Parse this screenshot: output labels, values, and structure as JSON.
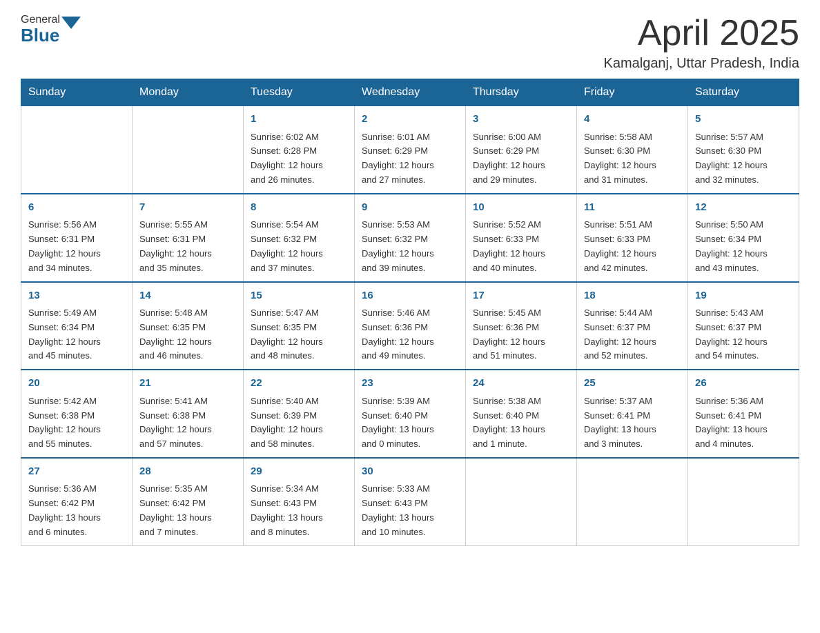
{
  "header": {
    "logo_general": "General",
    "logo_blue": "Blue",
    "month_title": "April 2025",
    "location": "Kamalganj, Uttar Pradesh, India"
  },
  "days_of_week": [
    "Sunday",
    "Monday",
    "Tuesday",
    "Wednesday",
    "Thursday",
    "Friday",
    "Saturday"
  ],
  "weeks": [
    [
      {
        "day": "",
        "info": ""
      },
      {
        "day": "",
        "info": ""
      },
      {
        "day": "1",
        "info": "Sunrise: 6:02 AM\nSunset: 6:28 PM\nDaylight: 12 hours\nand 26 minutes."
      },
      {
        "day": "2",
        "info": "Sunrise: 6:01 AM\nSunset: 6:29 PM\nDaylight: 12 hours\nand 27 minutes."
      },
      {
        "day": "3",
        "info": "Sunrise: 6:00 AM\nSunset: 6:29 PM\nDaylight: 12 hours\nand 29 minutes."
      },
      {
        "day": "4",
        "info": "Sunrise: 5:58 AM\nSunset: 6:30 PM\nDaylight: 12 hours\nand 31 minutes."
      },
      {
        "day": "5",
        "info": "Sunrise: 5:57 AM\nSunset: 6:30 PM\nDaylight: 12 hours\nand 32 minutes."
      }
    ],
    [
      {
        "day": "6",
        "info": "Sunrise: 5:56 AM\nSunset: 6:31 PM\nDaylight: 12 hours\nand 34 minutes."
      },
      {
        "day": "7",
        "info": "Sunrise: 5:55 AM\nSunset: 6:31 PM\nDaylight: 12 hours\nand 35 minutes."
      },
      {
        "day": "8",
        "info": "Sunrise: 5:54 AM\nSunset: 6:32 PM\nDaylight: 12 hours\nand 37 minutes."
      },
      {
        "day": "9",
        "info": "Sunrise: 5:53 AM\nSunset: 6:32 PM\nDaylight: 12 hours\nand 39 minutes."
      },
      {
        "day": "10",
        "info": "Sunrise: 5:52 AM\nSunset: 6:33 PM\nDaylight: 12 hours\nand 40 minutes."
      },
      {
        "day": "11",
        "info": "Sunrise: 5:51 AM\nSunset: 6:33 PM\nDaylight: 12 hours\nand 42 minutes."
      },
      {
        "day": "12",
        "info": "Sunrise: 5:50 AM\nSunset: 6:34 PM\nDaylight: 12 hours\nand 43 minutes."
      }
    ],
    [
      {
        "day": "13",
        "info": "Sunrise: 5:49 AM\nSunset: 6:34 PM\nDaylight: 12 hours\nand 45 minutes."
      },
      {
        "day": "14",
        "info": "Sunrise: 5:48 AM\nSunset: 6:35 PM\nDaylight: 12 hours\nand 46 minutes."
      },
      {
        "day": "15",
        "info": "Sunrise: 5:47 AM\nSunset: 6:35 PM\nDaylight: 12 hours\nand 48 minutes."
      },
      {
        "day": "16",
        "info": "Sunrise: 5:46 AM\nSunset: 6:36 PM\nDaylight: 12 hours\nand 49 minutes."
      },
      {
        "day": "17",
        "info": "Sunrise: 5:45 AM\nSunset: 6:36 PM\nDaylight: 12 hours\nand 51 minutes."
      },
      {
        "day": "18",
        "info": "Sunrise: 5:44 AM\nSunset: 6:37 PM\nDaylight: 12 hours\nand 52 minutes."
      },
      {
        "day": "19",
        "info": "Sunrise: 5:43 AM\nSunset: 6:37 PM\nDaylight: 12 hours\nand 54 minutes."
      }
    ],
    [
      {
        "day": "20",
        "info": "Sunrise: 5:42 AM\nSunset: 6:38 PM\nDaylight: 12 hours\nand 55 minutes."
      },
      {
        "day": "21",
        "info": "Sunrise: 5:41 AM\nSunset: 6:38 PM\nDaylight: 12 hours\nand 57 minutes."
      },
      {
        "day": "22",
        "info": "Sunrise: 5:40 AM\nSunset: 6:39 PM\nDaylight: 12 hours\nand 58 minutes."
      },
      {
        "day": "23",
        "info": "Sunrise: 5:39 AM\nSunset: 6:40 PM\nDaylight: 13 hours\nand 0 minutes."
      },
      {
        "day": "24",
        "info": "Sunrise: 5:38 AM\nSunset: 6:40 PM\nDaylight: 13 hours\nand 1 minute."
      },
      {
        "day": "25",
        "info": "Sunrise: 5:37 AM\nSunset: 6:41 PM\nDaylight: 13 hours\nand 3 minutes."
      },
      {
        "day": "26",
        "info": "Sunrise: 5:36 AM\nSunset: 6:41 PM\nDaylight: 13 hours\nand 4 minutes."
      }
    ],
    [
      {
        "day": "27",
        "info": "Sunrise: 5:36 AM\nSunset: 6:42 PM\nDaylight: 13 hours\nand 6 minutes."
      },
      {
        "day": "28",
        "info": "Sunrise: 5:35 AM\nSunset: 6:42 PM\nDaylight: 13 hours\nand 7 minutes."
      },
      {
        "day": "29",
        "info": "Sunrise: 5:34 AM\nSunset: 6:43 PM\nDaylight: 13 hours\nand 8 minutes."
      },
      {
        "day": "30",
        "info": "Sunrise: 5:33 AM\nSunset: 6:43 PM\nDaylight: 13 hours\nand 10 minutes."
      },
      {
        "day": "",
        "info": ""
      },
      {
        "day": "",
        "info": ""
      },
      {
        "day": "",
        "info": ""
      }
    ]
  ]
}
